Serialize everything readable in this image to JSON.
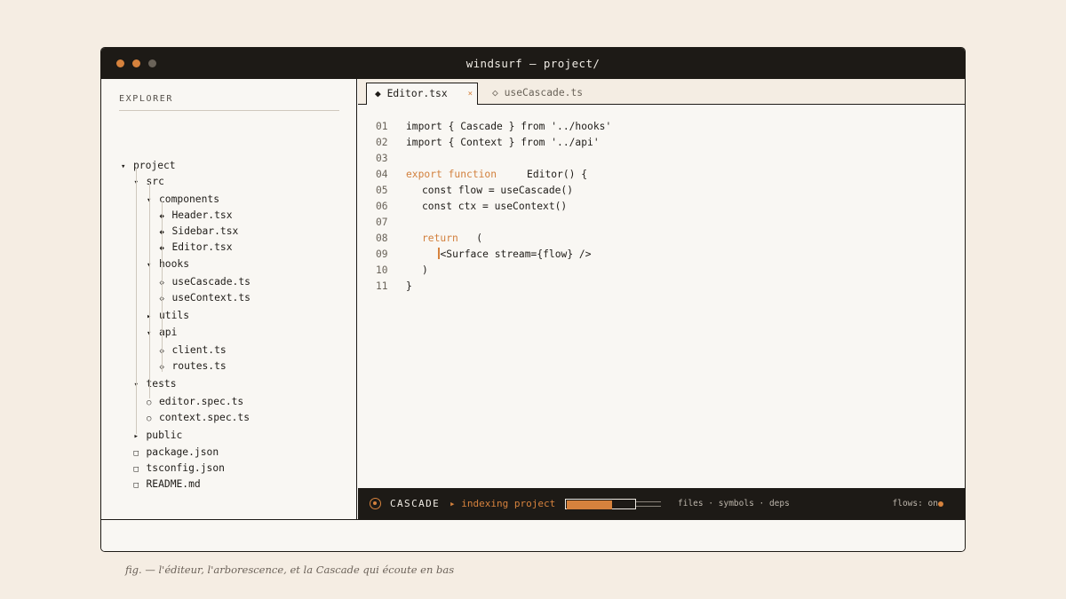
{
  "window": {
    "title": "windsurf — project/",
    "traffic_lights": [
      "#d6823d",
      "#d6823d",
      "#6a6359"
    ]
  },
  "explorer": {
    "label": "EXPLORER",
    "tree": [
      {
        "marker": "▾",
        "label": "project",
        "level": 0
      },
      {
        "marker": "▾",
        "label": "src",
        "level": 1
      },
      {
        "marker": "▾",
        "label": "components",
        "level": 2
      },
      {
        "marker": "◆",
        "label": "Header.tsx",
        "level": 3
      },
      {
        "marker": "◆",
        "label": "Sidebar.tsx",
        "level": 3
      },
      {
        "marker": "◆",
        "label": "Editor.tsx",
        "level": 3
      },
      {
        "marker": "▾",
        "label": "hooks",
        "level": 2
      },
      {
        "marker": "◇",
        "label": "useCascade.ts",
        "level": 3
      },
      {
        "marker": "◇",
        "label": "useContext.ts",
        "level": 3
      },
      {
        "marker": "▸",
        "label": "utils",
        "level": 2
      },
      {
        "marker": "▾",
        "label": "api",
        "level": 2
      },
      {
        "marker": "◇",
        "label": "client.ts",
        "level": 3
      },
      {
        "marker": "◇",
        "label": "routes.ts",
        "level": 3
      },
      {
        "marker": "▾",
        "label": "tests",
        "level": 1
      },
      {
        "marker": "○",
        "label": "editor.spec.ts",
        "level": 2
      },
      {
        "marker": "○",
        "label": "context.spec.ts",
        "level": 2
      },
      {
        "marker": "▸",
        "label": "public",
        "level": 1
      },
      {
        "marker": "□",
        "label": "package.json",
        "level": 1
      },
      {
        "marker": "□",
        "label": "tsconfig.json",
        "level": 1
      },
      {
        "marker": "□",
        "label": "README.md",
        "level": 1
      }
    ]
  },
  "tabs": {
    "active": {
      "icon": "◆",
      "label": "Editor.tsx",
      "close": "×"
    },
    "inactive": {
      "icon": "◇",
      "label": "useCascade.ts"
    }
  },
  "code_lines": [
    {
      "n": "01",
      "indent": 0,
      "kw": "",
      "text": "import { Cascade } from '../hooks'"
    },
    {
      "n": "02",
      "indent": 0,
      "kw": "",
      "text": "import { Context } from '../api'"
    },
    {
      "n": "03",
      "indent": 0,
      "kw": "",
      "text": ""
    },
    {
      "n": "04",
      "indent": 0,
      "kw": "export function",
      "text": "Editor() {"
    },
    {
      "n": "05",
      "indent": 1,
      "kw": "",
      "text": "const flow = useCascade()"
    },
    {
      "n": "06",
      "indent": 1,
      "kw": "",
      "text": "const ctx = useContext()"
    },
    {
      "n": "07",
      "indent": 0,
      "kw": "",
      "text": ""
    },
    {
      "n": "08",
      "indent": 1,
      "kw": "return",
      "text": "("
    },
    {
      "n": "09",
      "indent": 2,
      "kw": "",
      "text": "<Surface stream={flow} />",
      "cursor": true
    },
    {
      "n": "10",
      "indent": 1,
      "kw": "",
      "text": ")"
    },
    {
      "n": "11",
      "indent": 0,
      "kw": "",
      "text": "}"
    }
  ],
  "cascade": {
    "label": "CASCADE",
    "status": "▸ indexing project",
    "progress": 0.66,
    "tags": "files · symbols · deps",
    "flows": "flows: on"
  },
  "caption": "fig. — l'éditeur, l'arborescence, et la Cascade qui écoute en bas"
}
